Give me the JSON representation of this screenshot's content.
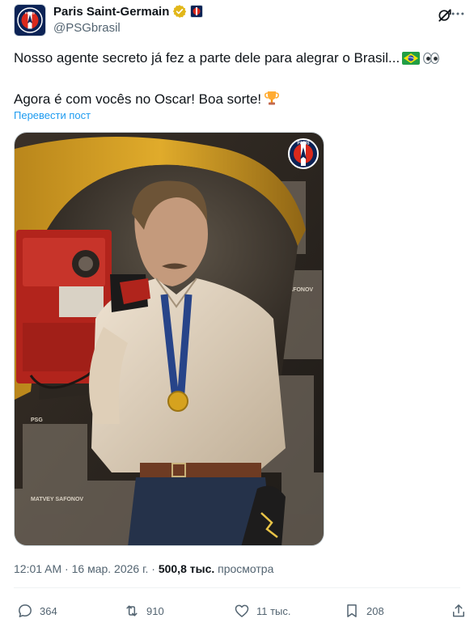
{
  "tweet": {
    "author": {
      "display_name": "Paris Saint-Germain",
      "handle": "@PSGbrasil",
      "avatar_icon": "psg-crest-icon",
      "verified_icon": "gold-verified-badge-icon",
      "affiliate_icon": "psg-affiliate-badge-icon"
    },
    "header_icons": [
      "grok-icon",
      "more-options-icon"
    ],
    "text_lines": [
      "Nosso agente secreto já fez a parte dele para alegrar o Brasil...",
      "Agora é com vocês no Oscar! Boa sorte!"
    ],
    "emojis": [
      "brazil-flag-emoji",
      "eyes-emoji",
      "trophy-emoji"
    ],
    "translate_link": "Перевести пост",
    "media": {
      "alt_icon": "psg-crest-icon",
      "poster_text": [
        "PSG",
        "MATVEY SAFONOV"
      ]
    },
    "meta": {
      "time": "12:01 AM",
      "separator": "·",
      "date": "16 мар. 2026 г.",
      "views": "500,8 тыс.",
      "views_label": "просмотра"
    },
    "actions": {
      "replies": "364",
      "reposts": "910",
      "likes": "11 тыс.",
      "bookmarks": "208"
    },
    "colors": {
      "link": "#1d9bf0",
      "secondary_text": "#536471",
      "primary_text": "#0f1419",
      "psg_navy": "#0c2356",
      "psg_red": "#da291c"
    }
  }
}
